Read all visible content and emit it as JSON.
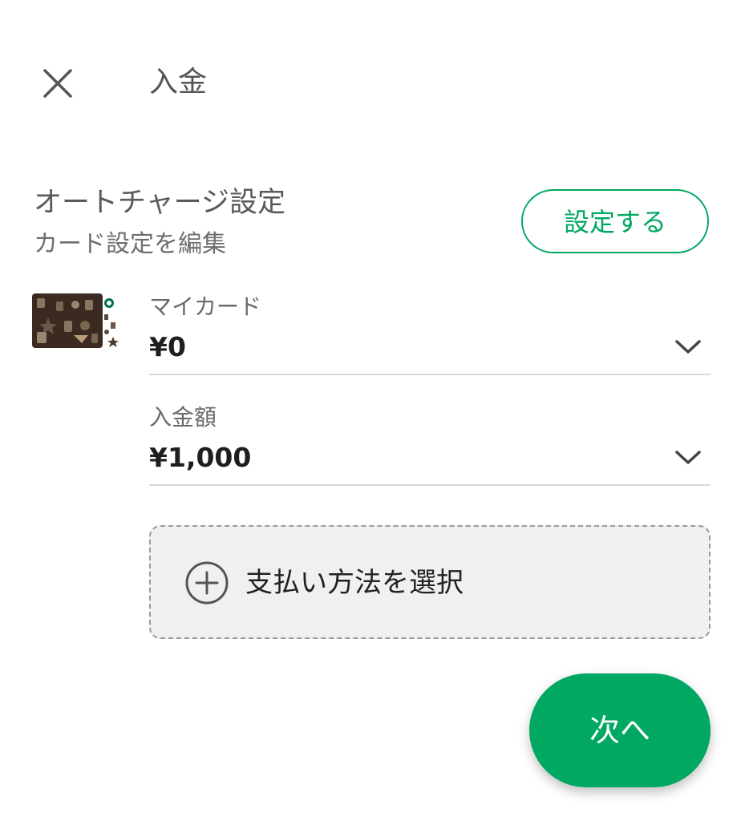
{
  "header": {
    "title": "入金",
    "close_icon": "close-icon"
  },
  "autocharge": {
    "title": "オートチャージ設定",
    "subtitle": "カード設定を編集",
    "button_label": "設定する"
  },
  "card": {
    "thumbnail": "starbucks-card-thumbnail",
    "label": "マイカード",
    "balance": "¥0"
  },
  "amount": {
    "label": "入金額",
    "value": "¥1,000"
  },
  "payment": {
    "label": "支払い方法を選択",
    "icon": "plus-circle-icon"
  },
  "footer": {
    "next_label": "次へ"
  },
  "colors": {
    "brand_green": "#00a862",
    "text_dark": "#222222",
    "text_muted": "#6a6a6a",
    "divider": "#d9d9d9",
    "dashed_box_bg": "#f0f0f0"
  }
}
